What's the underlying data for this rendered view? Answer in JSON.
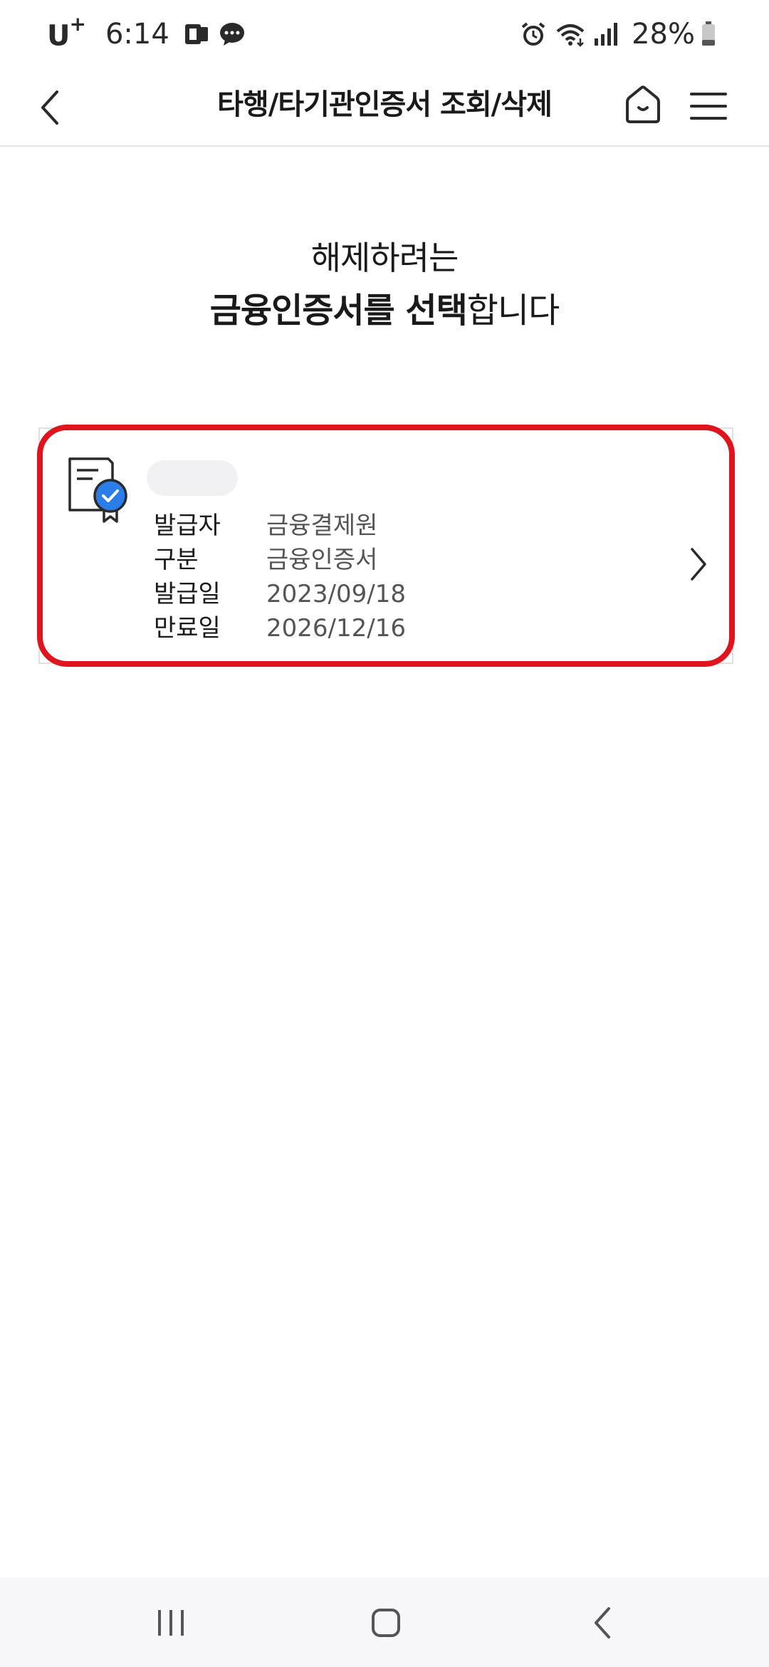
{
  "status_bar": {
    "carrier": "U",
    "carrier_sup": "+",
    "time": "6:14",
    "battery": "28%"
  },
  "header": {
    "title": "타행/타기관인증서 조회/삭제"
  },
  "heading": {
    "line1": "해제하려는",
    "line2_bold_1": "금융인증서를 선택",
    "line2_normal": "합니다"
  },
  "certificate": {
    "rows": [
      {
        "label": "발급자",
        "value": "금융결제원"
      },
      {
        "label": "구분",
        "value": "금융인증서"
      },
      {
        "label": "발급일",
        "value": "2023/09/18"
      },
      {
        "label": "만료일",
        "value": "2026/12/16"
      }
    ]
  },
  "colors": {
    "highlight": "#e0141d",
    "badge": "#2b7de9"
  }
}
